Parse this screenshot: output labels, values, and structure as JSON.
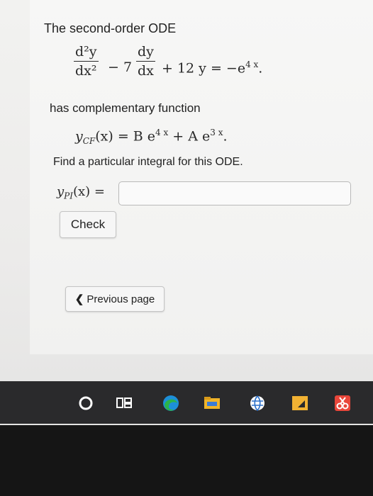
{
  "question": {
    "intro": "The second-order ODE",
    "ode": {
      "d2y": "d²y",
      "dx2": "dx²",
      "minus7": "− 7",
      "dy": "dy",
      "dx": "dx",
      "rhs": "+ 12 y = −e",
      "rhs_exp": "4 x",
      "rhs_end": "."
    },
    "cf_text": "has complementary function",
    "cf": {
      "lhs": "y",
      "lhs_sub": "CF",
      "mid": "(x) = B e",
      "exp1": "4 x",
      "plus": " + A e",
      "exp2": "3 x",
      "end": "."
    },
    "find_text": "Find a particular integral for this ODE.",
    "pi": {
      "lhs": "y",
      "lhs_sub": "PI",
      "rest": "(x) ="
    },
    "answer_value": ""
  },
  "buttons": {
    "check": "Check",
    "previous": "Previous page"
  },
  "colors": {
    "edge_green": "#2bb34a",
    "taskbar": "#2a2a2c"
  }
}
